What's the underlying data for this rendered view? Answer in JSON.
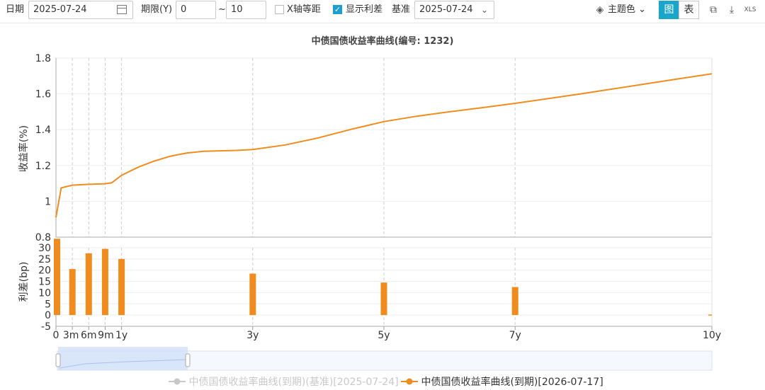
{
  "toolbar": {
    "date_label": "日期",
    "date_value": "2025-07-24",
    "term_label": "期限(Y)",
    "term_from": "0",
    "term_sep": "~",
    "term_to": "10",
    "equal_x_label": "X轴等距",
    "equal_x_checked": false,
    "show_spread_label": "显示利差",
    "show_spread_checked": true,
    "base_label": "基准",
    "base_value": "2025-07-24",
    "theme_label": "主题色",
    "view_chart": "图",
    "view_table": "表",
    "active_view": "chart"
  },
  "colors": {
    "accent": "#1aa6c8",
    "series_current": "#f08c1e",
    "series_base": "#c8c8c8"
  },
  "chart_data": {
    "type": "line",
    "title": "中债国债收益率曲线(编号: 1232)",
    "xlabel": "",
    "ylabel": "收益率(%)",
    "x_ticks": [
      {
        "x": 0,
        "label": "0"
      },
      {
        "x": 0.25,
        "label": "3m"
      },
      {
        "x": 0.5,
        "label": "6m"
      },
      {
        "x": 0.75,
        "label": "9m"
      },
      {
        "x": 1,
        "label": "1y"
      },
      {
        "x": 3,
        "label": "3y"
      },
      {
        "x": 5,
        "label": "5y"
      },
      {
        "x": 7,
        "label": "7y"
      },
      {
        "x": 10,
        "label": "10y"
      }
    ],
    "xlim": [
      0,
      10
    ],
    "ylim": [
      0.8,
      1.8
    ],
    "yticks": [
      0.8,
      1,
      1.2,
      1.4,
      1.6,
      1.8
    ],
    "series": [
      {
        "name": "中债国债收益率曲线(到期)(基准)[2025-07-24]",
        "visible": false,
        "x": [],
        "y": []
      },
      {
        "name": "中债国债收益率曲线(到期)[2026-07-17]",
        "visible": true,
        "x": [
          0,
          0.08,
          0.25,
          0.5,
          0.75,
          0.85,
          1,
          1.25,
          1.5,
          1.75,
          2,
          2.25,
          2.5,
          2.75,
          3,
          3.5,
          4,
          4.5,
          5,
          5.5,
          6,
          6.5,
          7,
          7.5,
          8,
          8.5,
          9,
          9.5,
          10
        ],
        "y": [
          0.91,
          1.075,
          1.09,
          1.095,
          1.098,
          1.103,
          1.145,
          1.19,
          1.225,
          1.252,
          1.27,
          1.279,
          1.282,
          1.284,
          1.289,
          1.315,
          1.354,
          1.402,
          1.445,
          1.475,
          1.5,
          1.523,
          1.547,
          1.573,
          1.6,
          1.628,
          1.656,
          1.684,
          1.712
        ]
      }
    ],
    "spread": {
      "type": "bar",
      "ylabel": "利差(bp)",
      "ylim": [
        -5,
        30
      ],
      "yticks": [
        -5,
        0,
        5,
        10,
        15,
        20,
        25,
        30
      ],
      "x": [
        0,
        0.25,
        0.5,
        0.75,
        1,
        3,
        5,
        7,
        10
      ],
      "values": [
        34,
        20.5,
        27.5,
        29.5,
        25,
        18.5,
        14.5,
        12.5,
        0
      ]
    },
    "legend_position": "bottom-center"
  }
}
